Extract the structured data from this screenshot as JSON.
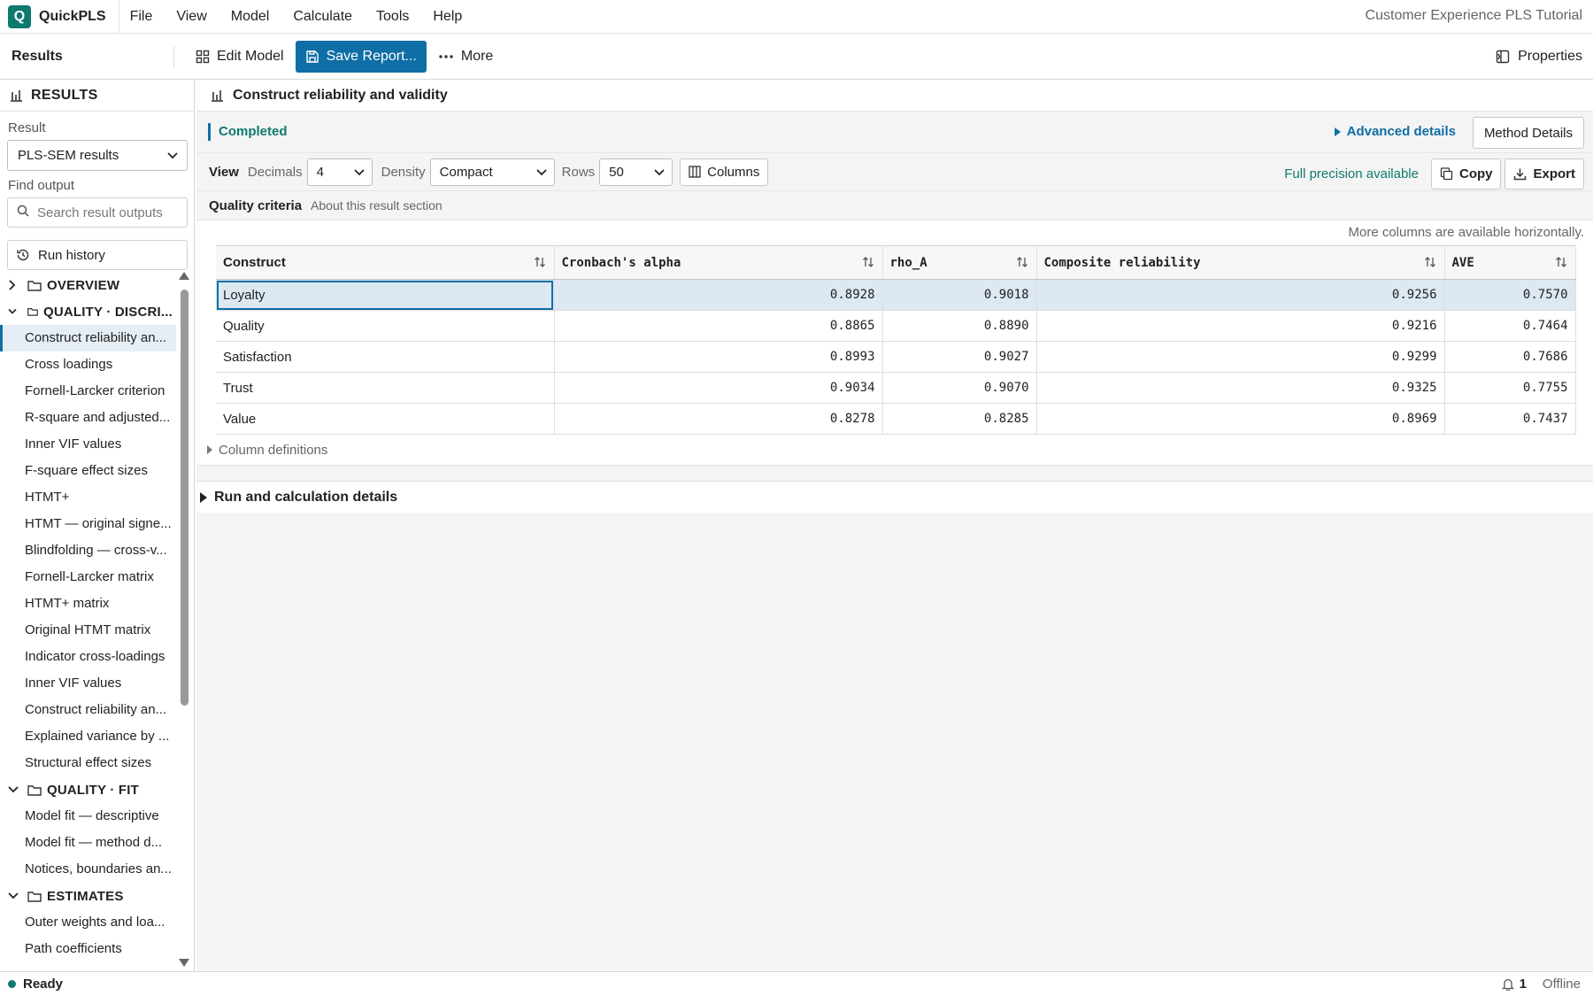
{
  "app": {
    "logo_letter": "Q",
    "name": "QuickPLS",
    "document_title": "Customer Experience PLS Tutorial"
  },
  "menu": [
    "File",
    "View",
    "Model",
    "Calculate",
    "Tools",
    "Help"
  ],
  "toolbar": {
    "section": "Results",
    "edit_model": "Edit Model",
    "save_report": "Save Report...",
    "more": "More",
    "properties": "Properties"
  },
  "sidebar": {
    "title": "RESULTS",
    "result_label": "Result",
    "result_value": "PLS-SEM results",
    "find_label": "Find output",
    "search_placeholder": "Search result outputs",
    "run_history": "Run history",
    "groups": [
      {
        "label": "OVERVIEW",
        "expanded": false,
        "items": []
      },
      {
        "label": "QUALITY · DISCRI...",
        "expanded": true,
        "items": [
          "Construct reliability an...",
          "Cross loadings",
          "Fornell-Larcker criterion",
          "R-square and adjusted...",
          "Inner VIF values",
          "F-square effect sizes",
          "HTMT+",
          "HTMT — original signe...",
          "Blindfolding — cross-v...",
          "Fornell-Larcker matrix",
          "HTMT+ matrix",
          "Original HTMT matrix",
          "Indicator cross-loadings",
          "Inner VIF values",
          "Construct reliability an...",
          "Explained variance by ...",
          "Structural effect sizes"
        ]
      },
      {
        "label": "QUALITY · FIT",
        "expanded": true,
        "items": [
          "Model fit — descriptive",
          "Model fit — method d...",
          "Notices, boundaries an..."
        ]
      },
      {
        "label": "ESTIMATES",
        "expanded": true,
        "items": [
          "Outer weights and loa...",
          "Path coefficients"
        ]
      }
    ],
    "active_item": "Construct reliability an..."
  },
  "main": {
    "title": "Construct reliability and validity",
    "status": "Completed",
    "advanced_details": "Advanced details",
    "method_details": "Method Details",
    "view": {
      "label": "View",
      "decimals_label": "Decimals",
      "decimals_value": "4",
      "density_label": "Density",
      "density_value": "Compact",
      "rows_label": "Rows",
      "rows_value": "50",
      "columns_button": "Columns",
      "full_precision": "Full precision available",
      "copy": "Copy",
      "export": "Export"
    },
    "section": {
      "title": "Quality criteria",
      "about": "About this result section"
    },
    "more_columns_note": "More columns are available horizontally.",
    "table": {
      "columns": [
        "Construct",
        "Cronbach's alpha",
        "rho_A",
        "Composite reliability",
        "AVE"
      ],
      "rows": [
        [
          "Loyalty",
          "0.8928",
          "0.9018",
          "0.9256",
          "0.7570"
        ],
        [
          "Quality",
          "0.8865",
          "0.8890",
          "0.9216",
          "0.7464"
        ],
        [
          "Satisfaction",
          "0.8993",
          "0.9027",
          "0.9299",
          "0.7686"
        ],
        [
          "Trust",
          "0.9034",
          "0.9070",
          "0.9325",
          "0.7755"
        ],
        [
          "Value",
          "0.8278",
          "0.8285",
          "0.8969",
          "0.7437"
        ]
      ],
      "selected_row": 0
    },
    "column_definitions": "Column definitions",
    "run_details": "Run and calculation details"
  },
  "statusbar": {
    "status": "Ready",
    "notifications": "1",
    "connection": "Offline"
  },
  "colors": {
    "brand": "#0e7a6e",
    "primary": "#0f6ea5",
    "selected_row": "#dce8f2"
  }
}
